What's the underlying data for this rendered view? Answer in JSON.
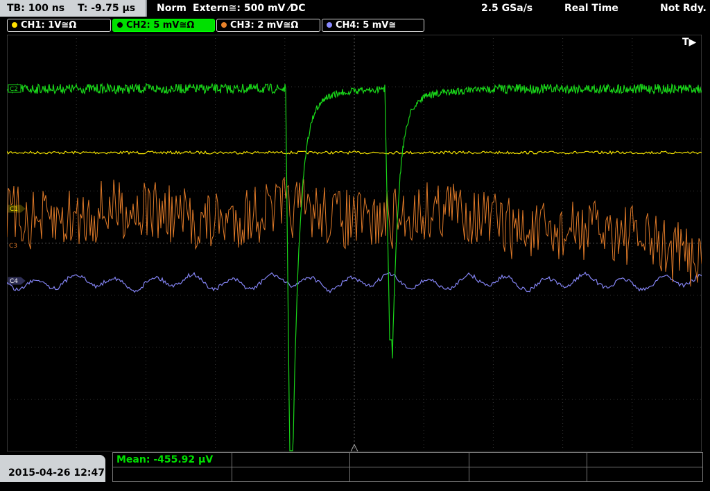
{
  "topbar": {
    "timebase": "TB: 100 ns",
    "trigger_time": "T: -9.75 µs",
    "trigger_mode": "Norm",
    "trigger_source": "Extern≅: 500 mV ⁄DC",
    "sample_rate": "2.5 GSa/s",
    "acq_mode": "Real Time",
    "status": "Not Rdy."
  },
  "channels": [
    {
      "label": "CH1: 1V≅Ω",
      "color": "#ffe000"
    },
    {
      "label": "CH2: 5 mV≅Ω",
      "color": "#00e000"
    },
    {
      "label": "CH3: 2 mV≅Ω",
      "color": "#e8822a"
    },
    {
      "label": "CH4: 5 mV≅",
      "color": "#8a8aff"
    }
  ],
  "markers": {
    "trigger_marker": "T▶",
    "c2": "C2",
    "c1": "C1",
    "c3": "C3",
    "c4": "C4"
  },
  "footer": {
    "datetime": "2015-04-26 12:47",
    "measurement": "Mean: -455.92 µV"
  }
}
